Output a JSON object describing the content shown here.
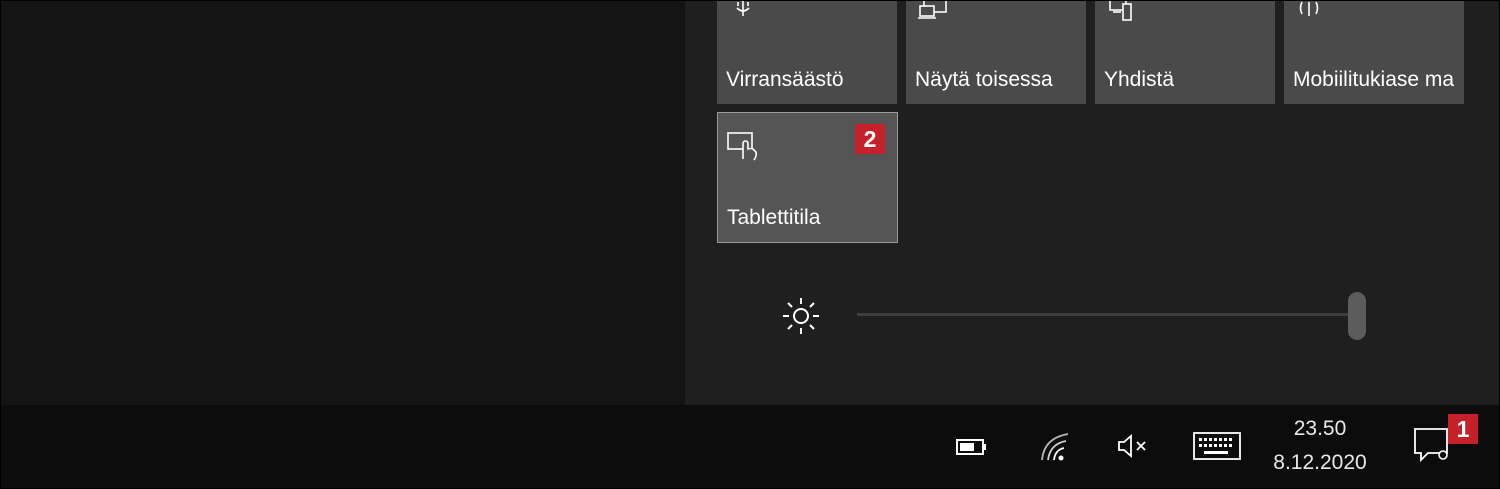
{
  "quick_actions": {
    "tiles": [
      {
        "label": "Virransäästö",
        "icon": "battery-saver-icon"
      },
      {
        "label": "Näytä toisessa",
        "icon": "project-display-icon"
      },
      {
        "label": "Yhdistä",
        "icon": "connect-icon"
      },
      {
        "label": "Mobiilitukiase ma",
        "icon": "mobile-hotspot-icon"
      },
      {
        "label": "Tablettitila",
        "icon": "tablet-mode-icon",
        "active": true
      }
    ],
    "badge_tablet": "2"
  },
  "brightness": {
    "icon": "brightness-icon",
    "level_percent": 100
  },
  "taskbar": {
    "time": "23.50",
    "date": "8.12.2020",
    "notification_badge": "1",
    "tray_icons": [
      "battery-icon",
      "wifi-icon",
      "volume-muted-icon",
      "keyboard-icon",
      "notification-icon"
    ]
  },
  "colors": {
    "badge": "#c6202a",
    "tile": "#4a4a4a",
    "tile_active_border": "#9a9a9a",
    "panel": "#1f1f1f",
    "taskbar": "#0c0c0d"
  }
}
